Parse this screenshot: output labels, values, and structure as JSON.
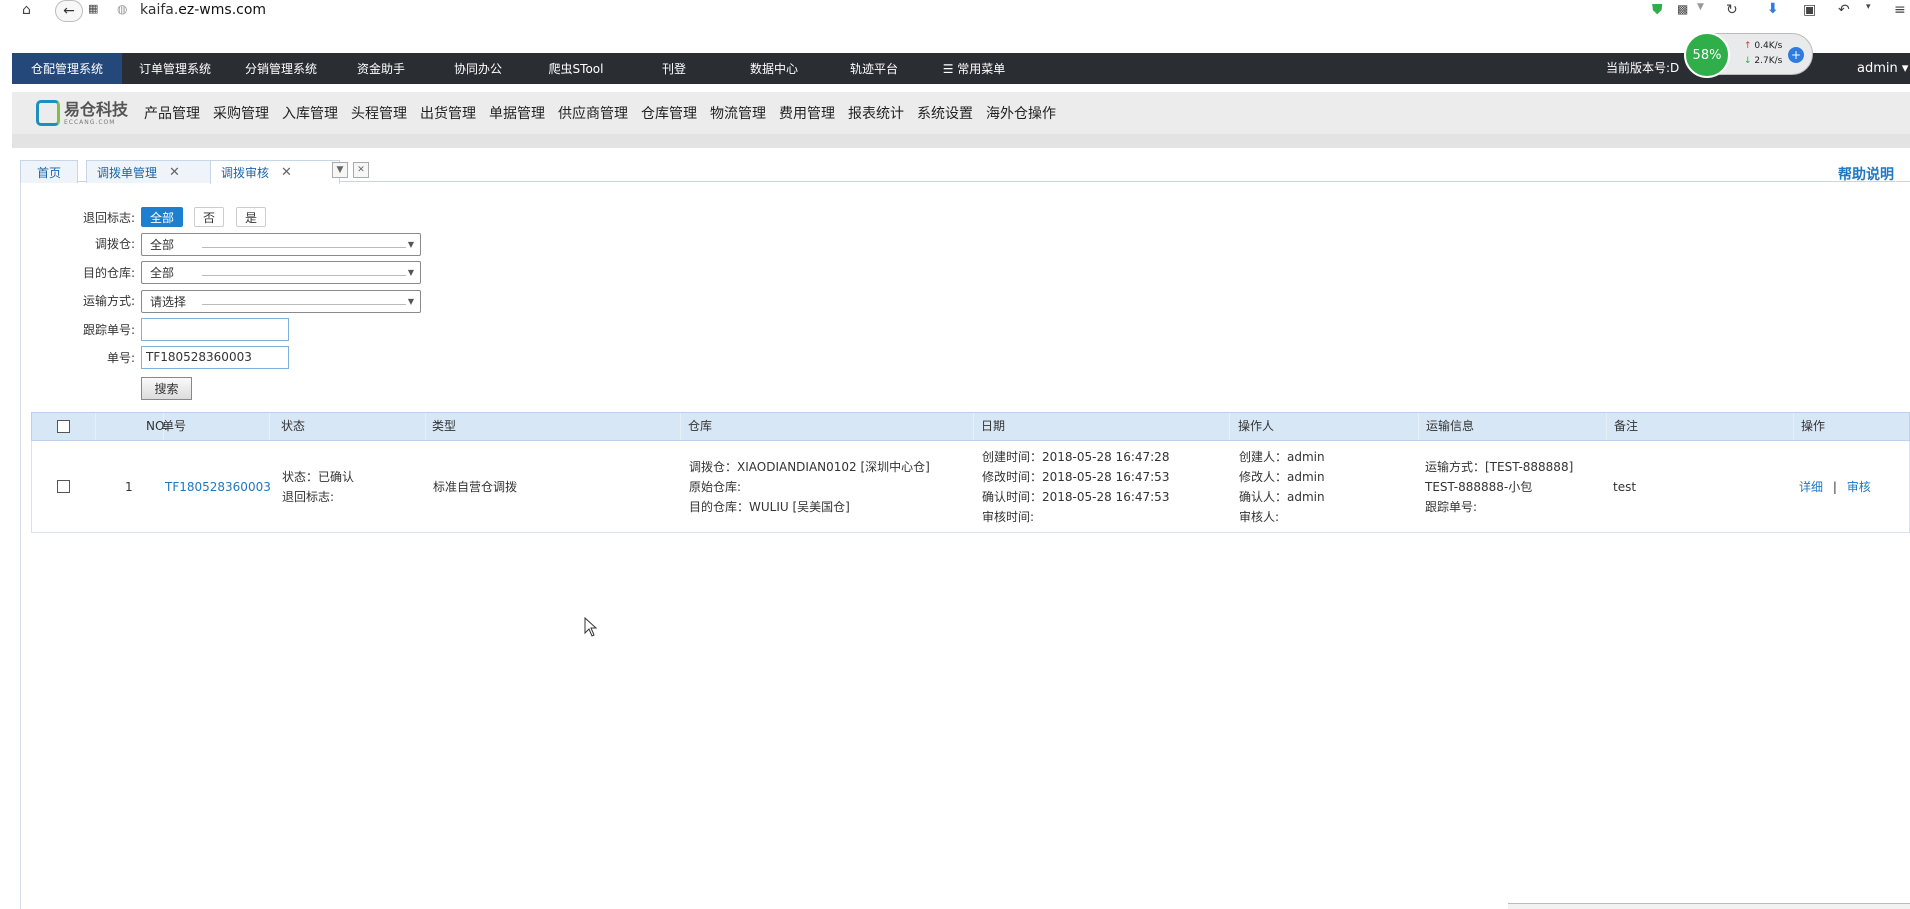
{
  "browser": {
    "url_prefix": "kaifa.",
    "url_domain": "ez-wms.com"
  },
  "topnav": {
    "items": [
      "仓配管理系统",
      "订单管理系统",
      "分销管理系统",
      "资金助手",
      "协同办公",
      "爬虫STool",
      "刊登",
      "数据中心",
      "轨迹平台",
      "☰ 常用菜单"
    ],
    "version_label": "当前版本号:D",
    "user": "admin ▾"
  },
  "netwidget": {
    "percent": "58%",
    "up": "0.4K/s",
    "down": "2.7K/s"
  },
  "brand": {
    "name": "易仓科技",
    "sub": "ECCANG.COM"
  },
  "secnav": {
    "items": [
      "产品管理",
      "采购管理",
      "入库管理",
      "头程管理",
      "出货管理",
      "单据管理",
      "供应商管理",
      "仓库管理",
      "物流管理",
      "费用管理",
      "报表统计",
      "系统设置",
      "海外仓操作"
    ]
  },
  "tabs": [
    {
      "label": "首页"
    },
    {
      "label": "调拨单管理"
    },
    {
      "label": "调拨审核"
    }
  ],
  "help": "帮助说明",
  "form": {
    "return_label": "退回标志:",
    "return_options": [
      "全部",
      "否",
      "是"
    ],
    "from_wh_label": "调拨仓:",
    "from_wh_value": "全部",
    "to_wh_label": "目的仓库:",
    "to_wh_value": "全部",
    "ship_label": "运输方式:",
    "ship_value": "请选择",
    "track_label": "跟踪单号:",
    "track_value": "",
    "order_label": "单号:",
    "order_value": "TF180528360003",
    "search_label": "搜索"
  },
  "table": {
    "headers": [
      "",
      "NO.",
      "单号",
      "状态",
      "类型",
      "仓库",
      "日期",
      "操作人",
      "运输信息",
      "备注",
      "操作"
    ],
    "rows": [
      {
        "no": "1",
        "order": "TF180528360003",
        "status": "状态：已确认",
        "return_flag": "退回标志:",
        "type": "标准自营仓调拨",
        "wh_from": "调拨仓：XIAODIANDIAN0102 [深圳中心仓]",
        "wh_origin": "原始仓库:",
        "wh_to": "目的仓库：WULIU [吴美国仓]",
        "created": "创建时间：2018-05-28 16:47:28",
        "modified": "修改时间：2018-05-28 16:47:53",
        "confirmed": "确认时间：2018-05-28 16:47:53",
        "audited": "审核时间:",
        "creator": "创建人：admin",
        "modifier": "修改人：admin",
        "confirmer": "确认人：admin",
        "auditor": "审核人:",
        "ship_method": "运输方式：[TEST-888888]",
        "ship_name": "TEST-888888-小包",
        "track_no": "跟踪单号:",
        "note": "test",
        "action_detail": "详细",
        "action_sep": "|",
        "action_audit": "审核"
      }
    ]
  }
}
